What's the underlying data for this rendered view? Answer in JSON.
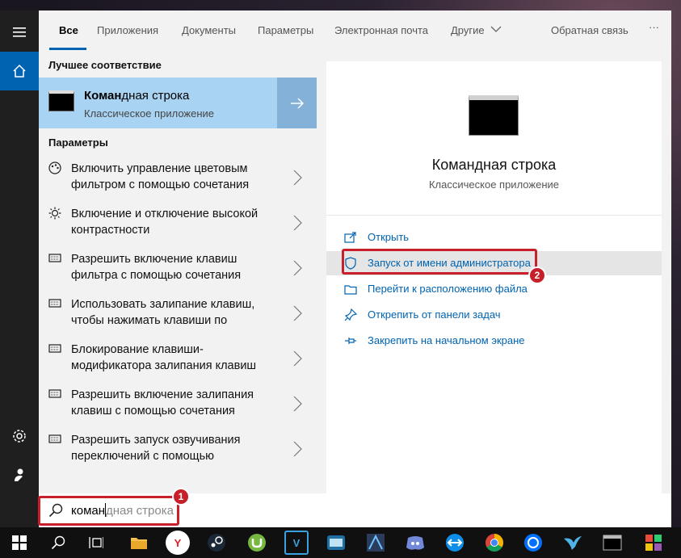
{
  "tabs": [
    {
      "label": "Все"
    },
    {
      "label": "Приложения"
    },
    {
      "label": "Документы"
    },
    {
      "label": "Параметры"
    },
    {
      "label": "Электронная почта"
    },
    {
      "label": "Другие"
    },
    {
      "label": "Обратная связь"
    },
    {
      "label": "···"
    }
  ],
  "left": {
    "best_match_header": "Лучшее соответствие",
    "best_match": {
      "title_bold": "Коман",
      "title_rest": "дная строка",
      "subtitle": "Классическое приложение",
      "icon": "cmd-icon"
    },
    "settings_header": "Параметры",
    "settings": [
      {
        "line1": "Включить управление цветовым",
        "line2": "фильтром с помощью сочетания",
        "icon": "palette-icon"
      },
      {
        "line1": "Включение и отключение высокой",
        "line2": "контрастности",
        "icon": "brightness-icon"
      },
      {
        "line1": "Разрешить включение клавиш",
        "line2": "фильтра с помощью сочетания",
        "icon": "keyboard-icon"
      },
      {
        "line1": "Использовать залипание клавиш,",
        "line2": "чтобы нажимать клавиши по",
        "icon": "keyboard-icon"
      },
      {
        "line1": "Блокирование клавиши-",
        "line2": "модификатора залипания клавиш",
        "icon": "keyboard-icon"
      },
      {
        "line1": "Разрешить включение залипания",
        "line2": "клавиш с помощью сочетания",
        "icon": "keyboard-icon"
      },
      {
        "line1": "Разрешить запуск озвучивания",
        "line2": "переключений с помощью",
        "icon": "keyboard-icon"
      }
    ]
  },
  "right": {
    "title": "Командная строка",
    "subtitle": "Классическое приложение",
    "actions": [
      {
        "label": "Открыть",
        "icon": "open-icon"
      },
      {
        "label": "Запуск от имени администратора",
        "icon": "shield-icon"
      },
      {
        "label": "Перейти к расположению файла",
        "icon": "folder-icon"
      },
      {
        "label": "Открепить от панели задач",
        "icon": "unpin-icon"
      },
      {
        "label": "Закрепить на начальном экране",
        "icon": "pin-icon"
      }
    ]
  },
  "search": {
    "typed": "коман",
    "suggestion": "дная строка"
  },
  "badges": {
    "one": "1",
    "two": "2"
  },
  "taskbar": {
    "icons": [
      "windows-start-icon",
      "search-icon",
      "task-view-icon",
      "file-explorer-icon",
      "yandex-browser-icon",
      "steam-icon",
      "utorrent-icon",
      "v-app-icon",
      "media-app-icon",
      "game-app-icon",
      "discord-icon",
      "teamviewer-icon",
      "chrome-icon",
      "uplay-icon",
      "bird-app-icon",
      "cmd-taskbar-icon",
      "colorful-app-icon"
    ],
    "v_label": "V",
    "y_label": "Y"
  },
  "colors": {
    "accent": "#0063b1",
    "highlight": "#a9d3f3",
    "annotation": "#c8202b"
  }
}
